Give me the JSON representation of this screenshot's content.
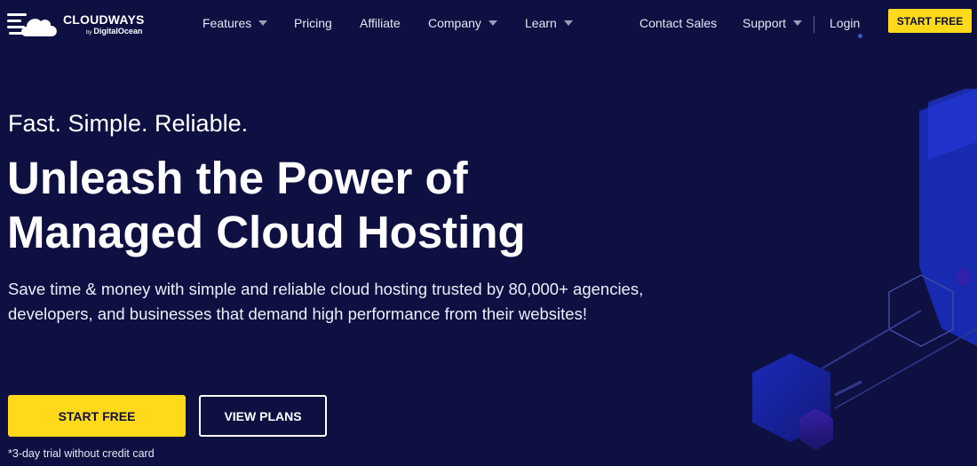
{
  "brand": {
    "name": "CLOUDWAYS",
    "by": "by",
    "parent": "DigitalOcean"
  },
  "nav": {
    "items": [
      {
        "label": "Features",
        "dropdown": true
      },
      {
        "label": "Pricing",
        "dropdown": false
      },
      {
        "label": "Affiliate",
        "dropdown": false
      },
      {
        "label": "Company",
        "dropdown": true
      },
      {
        "label": "Learn",
        "dropdown": true
      }
    ],
    "contact_sales": "Contact Sales",
    "support": "Support",
    "login": "Login",
    "start_free": "START FREE"
  },
  "hero": {
    "tagline": "Fast. Simple. Reliable.",
    "headline_line1": "Unleash the Power of",
    "headline_line2": "Managed Cloud Hosting",
    "description": "Save time & money with simple and reliable cloud hosting trusted by 80,000+ agencies, developers, and businesses that demand high performance from their websites!",
    "primary_cta": "START FREE",
    "secondary_cta": "VIEW PLANS",
    "trial_note": "*3-day trial without credit card"
  },
  "colors": {
    "background": "#0e1041",
    "accent_yellow": "#ffd91a",
    "text_white": "#ffffff"
  },
  "icons": [
    "cloudways-logo-icon",
    "chevron-down-icon"
  ]
}
